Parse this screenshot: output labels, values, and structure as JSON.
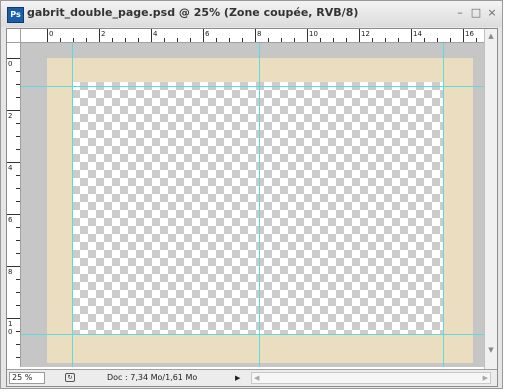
{
  "window": {
    "title": "gabrit_double_page.psd @ 25% (Zone coupée, RVB/8)",
    "app_badge": "Ps",
    "controls": {
      "minimize": "–",
      "maximize": "□",
      "close": "×"
    }
  },
  "ruler": {
    "top_labels": [
      "0",
      "2",
      "4",
      "6",
      "8",
      "10",
      "12",
      "14",
      "16"
    ],
    "left_labels": [
      "0",
      "2",
      "4",
      "6",
      "8",
      "1\n0"
    ]
  },
  "status": {
    "zoom": "25 %",
    "doc_info": "Doc : 7,34 Mo/1,61 Mo"
  },
  "icons": {
    "app": "photoshop-icon",
    "status": "document-status-icon",
    "menu_arrow": "play-arrow-icon"
  },
  "colors": {
    "page_bleed": "#ebddbf",
    "workspace": "#c6c6c6",
    "guides": "#5fd9d9"
  }
}
